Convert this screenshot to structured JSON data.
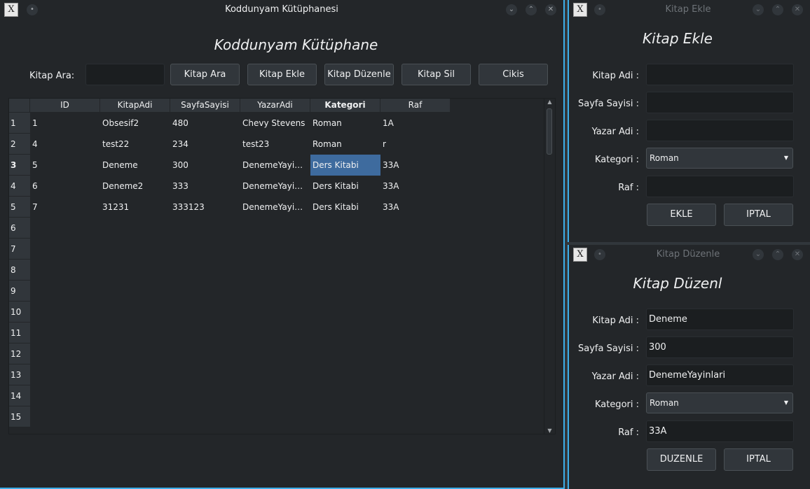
{
  "main": {
    "window_title": "Koddunyam Kütüphanesi",
    "heading": "Koddunyam Kütüphane",
    "search_label": "Kitap Ara:",
    "search_value": "",
    "buttons": {
      "search": "Kitap Ara",
      "add": "Kitap Ekle",
      "edit": "Kitap Düzenle",
      "delete": "Kitap Sil",
      "exit": "Cikis"
    },
    "table": {
      "columns": [
        "ID",
        "KitapAdi",
        "SayfaSayisi",
        "YazarAdi",
        "Kategori",
        "Raf"
      ],
      "row_numbers": [
        "1",
        "2",
        "3",
        "4",
        "5",
        "6",
        "7",
        "8",
        "9",
        "10",
        "11",
        "12",
        "13",
        "14",
        "15"
      ],
      "rows": [
        [
          "1",
          "Obsesif2",
          "480",
          "Chevy Stevens",
          "Roman",
          "1A"
        ],
        [
          "4",
          "test22",
          "234",
          "test23",
          "Roman",
          "r"
        ],
        [
          "5",
          "Deneme",
          "300",
          "DenemeYayi…",
          "Ders Kitabi",
          "33A"
        ],
        [
          "6",
          "Deneme2",
          "333",
          "DenemeYayi…",
          "Ders Kitabi",
          "33A"
        ],
        [
          "7",
          "31231",
          "333123",
          "DenemeYayi…",
          "Ders Kitabi",
          "33A"
        ]
      ]
    }
  },
  "add_window": {
    "window_title": "Kitap Ekle",
    "heading": "Kitap Ekle",
    "labels": {
      "name": "Kitap Adi :",
      "pages": "Sayfa Sayisi :",
      "author": "Yazar Adi :",
      "category": "Kategori :",
      "shelf": "Raf :"
    },
    "values": {
      "name": "",
      "pages": "",
      "author": "",
      "category": "Roman",
      "shelf": ""
    },
    "buttons": {
      "ok": "EKLE",
      "cancel": "IPTAL"
    }
  },
  "edit_window": {
    "window_title": "Kitap Düzenle",
    "heading": "Kitap Düzenl",
    "labels": {
      "name": "Kitap Adi :",
      "pages": "Sayfa Sayisi :",
      "author": "Yazar Adi :",
      "category": "Kategori :",
      "shelf": "Raf :"
    },
    "values": {
      "name": "Deneme",
      "pages": "300",
      "author": "DenemeYayinlari",
      "category": "Roman",
      "shelf": "33A"
    },
    "buttons": {
      "ok": "DUZENLE",
      "cancel": "IPTAL"
    }
  },
  "titlebar_icons": [
    "app-icon",
    "pin-icon",
    "minimize-icon",
    "maximize-icon",
    "close-icon"
  ]
}
